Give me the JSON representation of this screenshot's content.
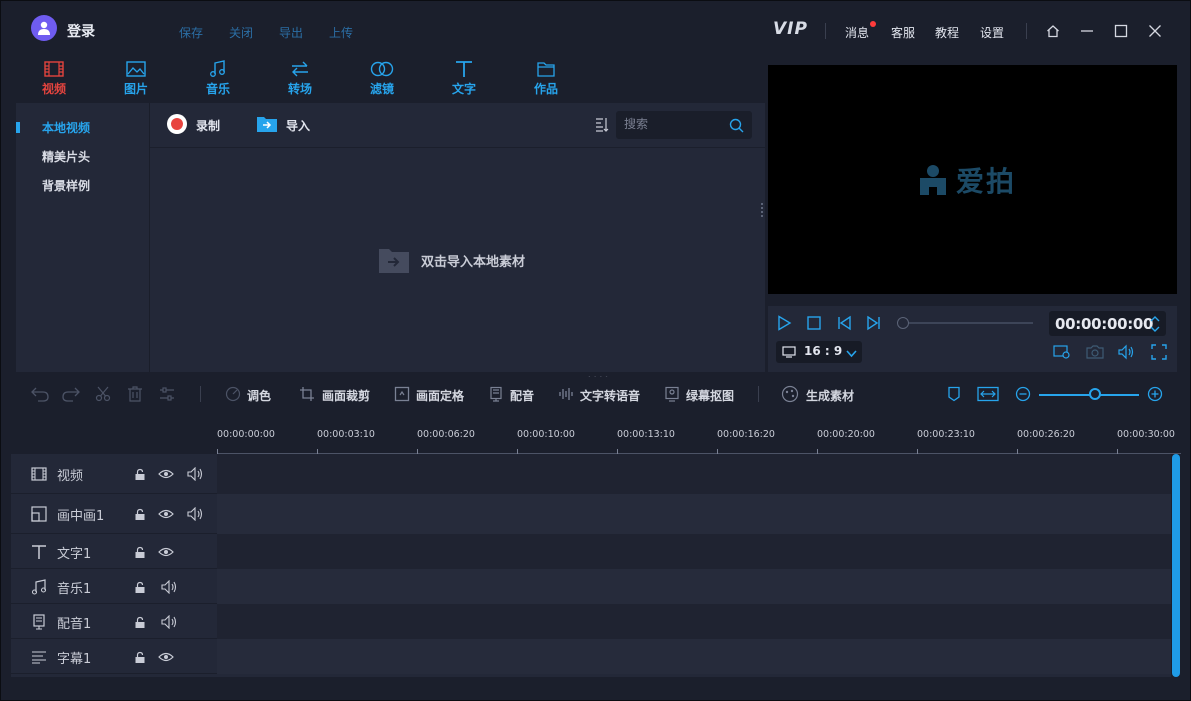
{
  "titlebar": {
    "login": "登录",
    "menu": [
      "保存",
      "关闭",
      "导出",
      "上传"
    ],
    "vip": "VIP",
    "messages": "消息",
    "service": "客服",
    "tutorial": "教程",
    "settings": "设置"
  },
  "categories": [
    "视频",
    "图片",
    "音乐",
    "转场",
    "滤镜",
    "文字",
    "作品"
  ],
  "library": {
    "side_items": [
      "本地视频",
      "精美片头",
      "背景样例"
    ],
    "record": "录制",
    "import": "导入",
    "search_placeholder": "搜索",
    "empty_hint": "双击导入本地素材"
  },
  "preview": {
    "logo_text": "爱拍",
    "timecode": "00:00:00:00",
    "aspect_ratio": "16 : 9",
    "progress": 0
  },
  "timeline_toolbar": {
    "color_grade": "调色",
    "crop": "画面裁剪",
    "pip_position": "画面定格",
    "dubbing": "配音",
    "text_to_speech": "文字转语音",
    "green_screen": "绿幕抠图",
    "generate_material": "生成素材"
  },
  "ruler": [
    "00:00:00:00",
    "00:00:03:10",
    "00:00:06:20",
    "00:00:10:00",
    "00:00:13:10",
    "00:00:16:20",
    "00:00:20:00",
    "00:00:23:10",
    "00:00:26:20",
    "00:00:30:00"
  ],
  "tracks": [
    "视频",
    "画中画1",
    "文字1",
    "音乐1",
    "配音1",
    "字幕1"
  ],
  "colors": {
    "accent": "#27a4ec",
    "active_tab": "#e4443e",
    "panel": "#232838",
    "background": "#1b1f2c"
  }
}
